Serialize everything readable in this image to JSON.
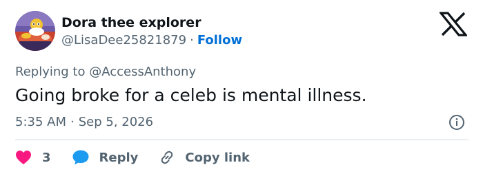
{
  "author": {
    "display_name": "Dora thee explorer",
    "handle": "@LisaDee25821879",
    "separator": "·",
    "follow_label": "Follow"
  },
  "reply_context": {
    "prefix": "Replying to",
    "mention": "@AccessAnthony"
  },
  "tweet": {
    "text": "Going broke for a celeb is mental illness.",
    "time": "5:35 AM",
    "separator": "·",
    "date": "Sep 5, 2026"
  },
  "actions": {
    "like_count": "3",
    "reply_label": "Reply",
    "copy_link_label": "Copy link"
  },
  "icons": {
    "brand": "x-logo-icon",
    "info": "info-icon",
    "like": "heart-icon",
    "reply": "speech-bubble-icon",
    "copy": "link-icon"
  },
  "colors": {
    "text_primary": "#0f1419",
    "text_secondary": "#536471",
    "link": "#006fd6",
    "like": "#f91880",
    "reply_icon": "#1d9bf0",
    "divider": "#cfd9de"
  }
}
